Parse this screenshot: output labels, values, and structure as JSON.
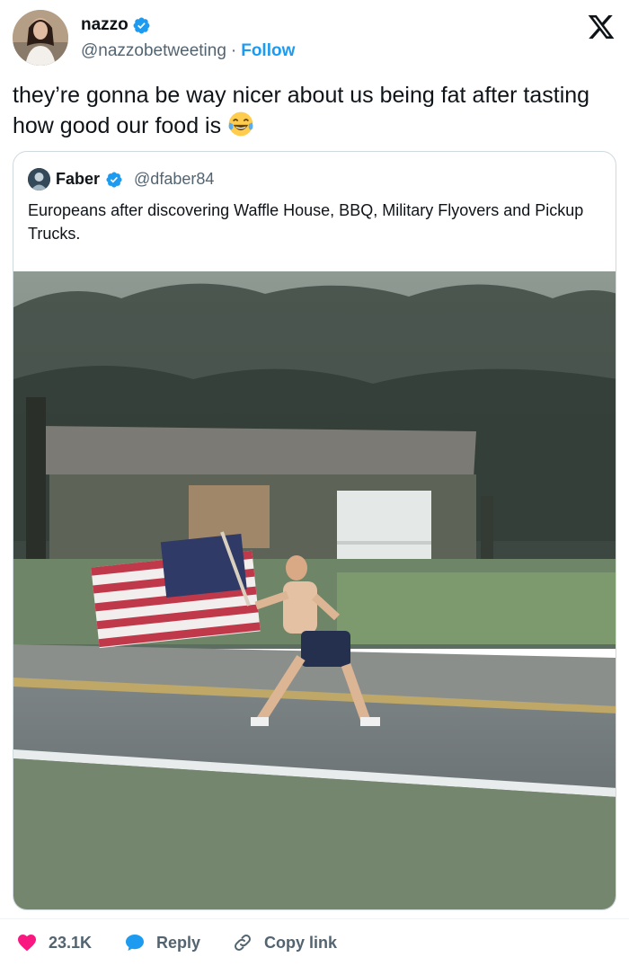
{
  "author": {
    "name": "nazzo",
    "handle": "@nazzobetweeting",
    "separator": "·",
    "follow_label": "Follow"
  },
  "tweet": {
    "text": "they’re gonna be way nicer about us being fat after tasting how good our food is",
    "emoji": "face-with-tears-of-joy-icon"
  },
  "quoted": {
    "name": "Faber",
    "handle": "@dfaber84",
    "text": "Europeans after discovering Waffle House, BBQ, Military Flyovers and Pickup Trucks."
  },
  "actions": {
    "likes": "23.1K",
    "reply_label": "Reply",
    "copy_label": "Copy link"
  },
  "colors": {
    "accent": "#1d9bf0",
    "like": "#f91880",
    "verified": "#1d9bf0"
  }
}
